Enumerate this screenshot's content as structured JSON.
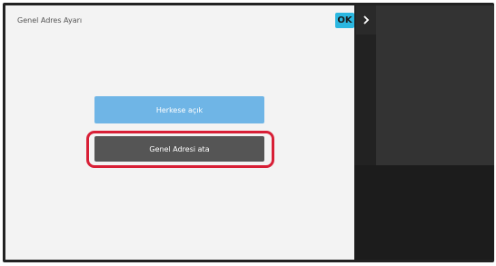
{
  "dialog": {
    "title": "Genel Adres Ayarı",
    "ok_label": "OK"
  },
  "side_tab": {
    "icon": "chevron-right-icon"
  },
  "buttons": {
    "open_to_all": "Herkese açık",
    "assign_public_address": "Genel Adresi ata"
  },
  "colors": {
    "accent_ok": "#2bb7e0",
    "primary_button": "#6fb5e6",
    "dark_button": "#555555",
    "highlight": "#d81f36"
  }
}
